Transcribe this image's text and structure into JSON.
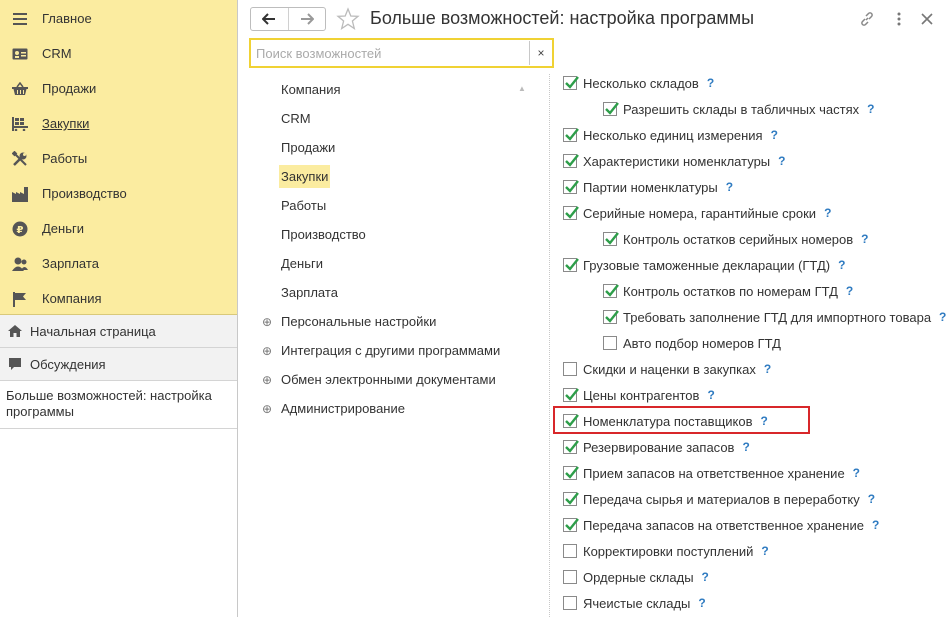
{
  "sidebar": {
    "sections": [
      {
        "label": "Главное",
        "icon": "menu-icon"
      },
      {
        "label": "CRM",
        "icon": "crm-card-icon"
      },
      {
        "label": "Продажи",
        "icon": "basket-icon"
      },
      {
        "label": "Закупки",
        "icon": "purchases-grid-icon"
      },
      {
        "label": "Работы",
        "icon": "tools-icon"
      },
      {
        "label": "Производство",
        "icon": "factory-icon"
      },
      {
        "label": "Деньги",
        "icon": "ruble-coin-icon"
      },
      {
        "label": "Зарплата",
        "icon": "people-icon"
      },
      {
        "label": "Компания",
        "icon": "flag-icon"
      }
    ],
    "nav": {
      "home": "Начальная страница",
      "discussions": "Обсуждения"
    },
    "open_form": "Больше возможностей: настройка программы"
  },
  "header": {
    "title": "Больше возможностей: настройка программы"
  },
  "search": {
    "placeholder": "Поиск возможностей",
    "clear": "×"
  },
  "tree": {
    "items": [
      {
        "label": "Компания"
      },
      {
        "label": "CRM"
      },
      {
        "label": "Продажи"
      },
      {
        "label": "Закупки",
        "selected": true
      },
      {
        "label": "Работы"
      },
      {
        "label": "Производство"
      },
      {
        "label": "Деньги"
      },
      {
        "label": "Зарплата"
      },
      {
        "label": "Персональные настройки",
        "expandable": true
      },
      {
        "label": "Интеграция с другими программами",
        "expandable": true
      },
      {
        "label": "Обмен электронными документами",
        "expandable": true
      },
      {
        "label": "Администрирование",
        "expandable": true
      }
    ]
  },
  "options": [
    {
      "label": "Несколько складов",
      "checked": true,
      "indent": 0
    },
    {
      "label": "Разрешить склады в табличных частях",
      "checked": true,
      "indent": 1
    },
    {
      "label": "Несколько единиц измерения",
      "checked": true,
      "indent": 0
    },
    {
      "label": "Характеристики номенклатуры",
      "checked": true,
      "indent": 0
    },
    {
      "label": "Партии номенклатуры",
      "checked": true,
      "indent": 0
    },
    {
      "label": "Серийные номера, гарантийные сроки",
      "checked": true,
      "indent": 0
    },
    {
      "label": "Контроль остатков серийных номеров",
      "checked": true,
      "indent": 1
    },
    {
      "label": "Грузовые таможенные декларации (ГТД)",
      "checked": true,
      "indent": 0
    },
    {
      "label": "Контроль остатков по номерам ГТД",
      "checked": true,
      "indent": 1
    },
    {
      "label": "Требовать заполнение ГТД для импортного товара",
      "checked": true,
      "indent": 1
    },
    {
      "label": "Авто подбор номеров ГТД",
      "checked": false,
      "indent": 1,
      "no_help": true
    },
    {
      "label": "Скидки и наценки в закупках",
      "checked": false,
      "indent": 0
    },
    {
      "label": "Цены контрагентов",
      "checked": true,
      "indent": 0
    },
    {
      "label": "Номенклатура поставщиков",
      "checked": true,
      "indent": 0,
      "highlighted": true
    },
    {
      "label": "Резервирование запасов",
      "checked": true,
      "indent": 0
    },
    {
      "label": "Прием запасов на ответственное хранение",
      "checked": true,
      "indent": 0
    },
    {
      "label": "Передача сырья и материалов в переработку",
      "checked": true,
      "indent": 0
    },
    {
      "label": "Передача запасов на ответственное хранение",
      "checked": true,
      "indent": 0
    },
    {
      "label": "Корректировки поступлений",
      "checked": false,
      "indent": 0
    },
    {
      "label": "Ордерные склады",
      "checked": false,
      "indent": 0
    },
    {
      "label": "Ячеистые склады",
      "checked": false,
      "indent": 0
    }
  ],
  "help_glyph": "?",
  "colors": {
    "sections_bg": "#fbeca0",
    "selected_bg": "#fbeca0",
    "check_green": "#2e9e4a",
    "help_blue": "#2f7bc1",
    "highlight_red": "#d8272a",
    "search_border": "#f0d234"
  }
}
